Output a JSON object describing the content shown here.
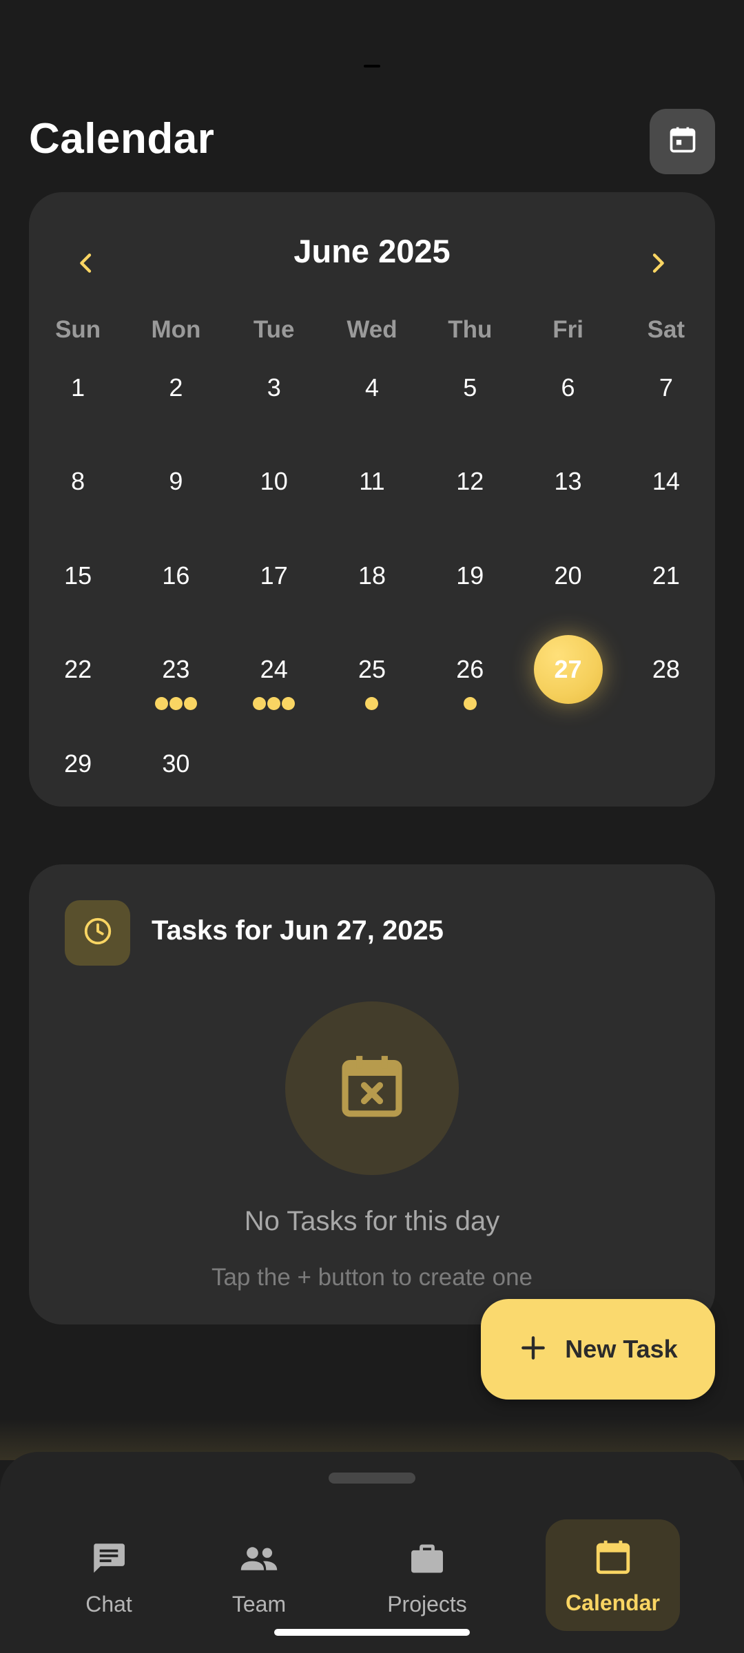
{
  "header": {
    "title": "Calendar",
    "today_button_icon": "calendar-today-icon"
  },
  "calendar": {
    "month_label": "June 2025",
    "prev_icon": "chevron-left-icon",
    "next_icon": "chevron-right-icon",
    "weekdays": [
      "Sun",
      "Mon",
      "Tue",
      "Wed",
      "Thu",
      "Fri",
      "Sat"
    ],
    "days": [
      "1",
      "2",
      "3",
      "4",
      "5",
      "6",
      "7",
      "8",
      "9",
      "10",
      "11",
      "12",
      "13",
      "14",
      "15",
      "16",
      "17",
      "18",
      "19",
      "20",
      "21",
      "22",
      "23",
      "24",
      "25",
      "26",
      "27",
      "28",
      "29",
      "30"
    ],
    "selected_day": "27",
    "task_dots": {
      "23": 3,
      "24": 3,
      "25": 1,
      "26": 1
    },
    "accent_color": "#f9d563"
  },
  "tasks": {
    "header_icon": "clock-icon",
    "title": "Tasks for Jun 27, 2025",
    "empty_icon": "calendar-remove-icon",
    "empty_title": "No Tasks for this day",
    "empty_subtitle": "Tap the + button to create one"
  },
  "fab": {
    "icon": "plus-icon",
    "label": "New Task"
  },
  "bottom_nav": {
    "items": [
      {
        "label": "Chat",
        "icon": "chat-icon"
      },
      {
        "label": "Team",
        "icon": "team-icon"
      },
      {
        "label": "Projects",
        "icon": "briefcase-icon"
      },
      {
        "label": "Calendar",
        "icon": "calendar-icon",
        "active": true
      }
    ]
  }
}
